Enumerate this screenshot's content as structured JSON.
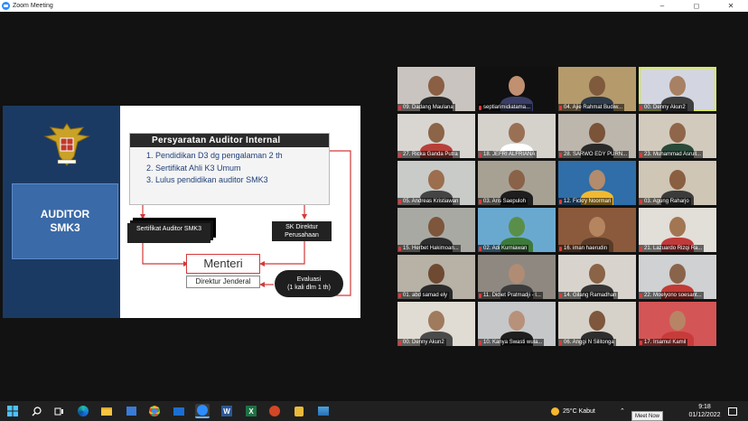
{
  "window": {
    "title": "Zoom Meeting",
    "controls": [
      "–",
      "◻",
      "✕"
    ]
  },
  "slide": {
    "auditor_title_line1": "AUDITOR",
    "auditor_title_line2": "SMK3",
    "req_heading": "Persyaratan Auditor Internal",
    "requirements": [
      "1.  Pendidikan D3  dg pengalaman 2 th",
      "2.  Sertifikat  Ahli K3 Umum",
      "3.  Lulus pendidikan auditor SMK3"
    ],
    "sertifikat": "Sertifikat Auditor SMK3",
    "sk": "SK Direktur Perusahaan",
    "menteri": "Menteri",
    "dirjen": "Direktur Jenderal",
    "evaluasi_line1": "Evaluasi",
    "evaluasi_line2": "(1 kali dlm 1 th)"
  },
  "participants": [
    {
      "name": "09. Dadang Maulana",
      "bg": "#c9c4bf",
      "skin": "#8a5f43",
      "shirt": "#2b2b2b"
    },
    {
      "name": "septiarimidiatama...",
      "bg": "#101010",
      "skin": "#c09070",
      "shirt": "#3a3e66"
    },
    {
      "name": "04. Ajie Rahmat Budiw...",
      "bg": "#b59a6b",
      "skin": "#7f5a3d",
      "shirt": "#2e3b4a"
    },
    {
      "name": "00. Denny Akun2",
      "bg": "#d3d6e0",
      "skin": "#a88063",
      "shirt": "#3e3e3e",
      "active": true
    },
    {
      "name": "27. Ricka Ganda Putra",
      "bg": "#d9d6d2",
      "skin": "#8c6447",
      "shirt": "#b8403a"
    },
    {
      "name": "18. JEFRI ALFRIANA",
      "bg": "#d5d2cc",
      "skin": "#9a7055",
      "shirt": "#ffffff"
    },
    {
      "name": "28. SARWO EDY PURN...",
      "bg": "#bcb6ad",
      "skin": "#7a5338",
      "shirt": "#2a2a2a"
    },
    {
      "name": "23. Muhammad Asrull...",
      "bg": "#d2cbbd",
      "skin": "#8f664a",
      "shirt": "#2a4a3a"
    },
    {
      "name": "05. Andreas Kristiawan",
      "bg": "#c8cbc8",
      "skin": "#9c6e4e",
      "shirt": "#444444"
    },
    {
      "name": "03. Aris Saepuloh",
      "bg": "#a7a194",
      "skin": "#8a6247",
      "shirt": "#1e1e1e"
    },
    {
      "name": "12. Fickry Noormari",
      "bg": "#2f6ea8",
      "skin": "#b38b6d",
      "shirt": "#f2b930"
    },
    {
      "name": "03. Agung Raharjo",
      "bg": "#cfc6b6",
      "skin": "#8a5e40",
      "shirt": "#3b3b3b"
    },
    {
      "name": "15. Herbet Hakimoan...",
      "bg": "#a9a9a4",
      "skin": "#7d563b",
      "shirt": "#2d2d2d"
    },
    {
      "name": "02. Adi Kurniawan",
      "bg": "#6aa9cf",
      "skin": "#5a8f4a",
      "shirt": "#3d7a3a"
    },
    {
      "name": "16. iman haerudin",
      "bg": "#8b5a3c",
      "skin": "#b4855f",
      "shirt": "#5a3b28"
    },
    {
      "name": "21. Lazuardo Rizqi Ra...",
      "bg": "#e2ded8",
      "skin": "#a27653",
      "shirt": "#c03a3a"
    },
    {
      "name": "01. abd samad ely",
      "bg": "#b7b1a6",
      "skin": "#6e4a32",
      "shirt": "#2b2b2b"
    },
    {
      "name": "11. Didiet Pratmadji - I...",
      "bg": "#8e8880",
      "skin": "#b08c74",
      "shirt": "#3b3b3b"
    },
    {
      "name": "14. Gilang Ramadhan",
      "bg": "#d8d4cd",
      "skin": "#8b6346",
      "shirt": "#353535"
    },
    {
      "name": "22. Moelyono soesant...",
      "bg": "#cfd1d3",
      "skin": "#8a644a",
      "shirt": "#c23b34"
    },
    {
      "name": "00. Denny Akun2",
      "bg": "#e0dcd3",
      "skin": "#a07a5d",
      "shirt": "#4a4a4a"
    },
    {
      "name": "10. Kanya Swasti wula...",
      "bg": "#c5c7c9",
      "skin": "#b8917a",
      "shirt": "#1e1e1e"
    },
    {
      "name": "06. Anggi N Silitonga",
      "bg": "#d6d2c9",
      "skin": "#7e573c",
      "shirt": "#2e2e2e"
    },
    {
      "name": "17. Irsamul Kamil",
      "bg": "#d45555",
      "skin": "#b88466",
      "shirt": "#c83b3b"
    }
  ],
  "taskbar": {
    "weather": "25°C  Kabut",
    "time": "9:18",
    "date": "01/12/2022",
    "meet_now": "Meet Now"
  }
}
